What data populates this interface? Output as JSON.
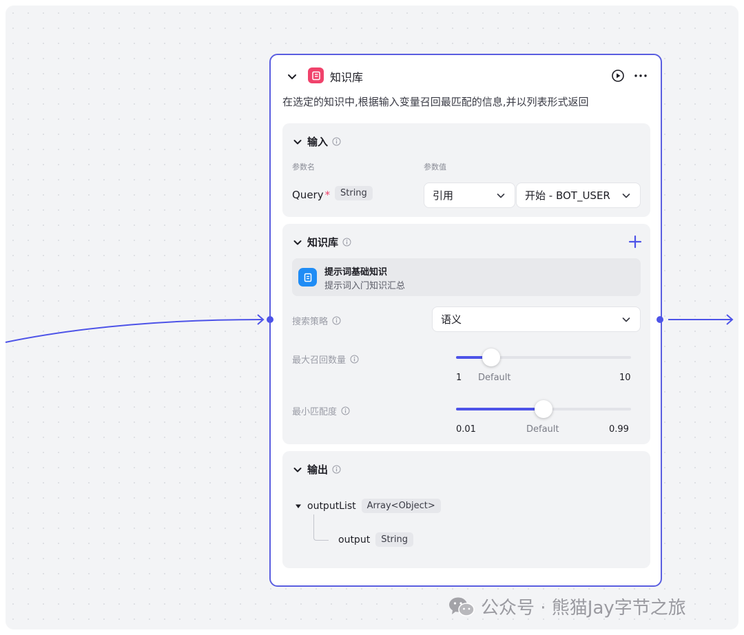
{
  "node": {
    "title": "知识库",
    "description": "在选定的知识中,根据输入变量召回最匹配的信息,并以列表形式返回"
  },
  "input": {
    "section_label": "输入",
    "col_param_name": "参数名",
    "col_param_value": "参数值",
    "param_name": "Query",
    "required_mark": "*",
    "param_type": "String",
    "ref_mode": "引用",
    "ref_value": "开始 - BOT_USER"
  },
  "knowledge": {
    "section_label": "知识库",
    "item_title": "提示词基础知识",
    "item_subtitle": "提示词入门知识汇总",
    "strategy_label": "搜索策略",
    "strategy_value": "语义",
    "max_recall_label": "最大召回数量",
    "max_recall": {
      "min_label": "1",
      "default_label": "Default",
      "max_label": "10",
      "fraction": 0.2
    },
    "min_match_label": "最小匹配度",
    "min_match": {
      "min_label": "0.01",
      "default_label": "Default",
      "max_label": "0.99",
      "fraction": 0.5
    }
  },
  "output": {
    "section_label": "输出",
    "list_name": "outputList",
    "list_type": "Array<Object>",
    "child_name": "output",
    "child_type": "String"
  },
  "watermark": {
    "text": "公众号 · 熊猫Jay字节之旅"
  },
  "colors": {
    "accent": "#4d53e8",
    "node_border": "#5a5ee0",
    "kb_icon": "#f0426b",
    "item_icon": "#1f8cf5"
  },
  "icons": [
    "chevron-down-icon",
    "knowledge-base-icon",
    "play-icon",
    "more-icon",
    "info-icon",
    "plus-icon",
    "document-icon",
    "wechat-icon"
  ]
}
